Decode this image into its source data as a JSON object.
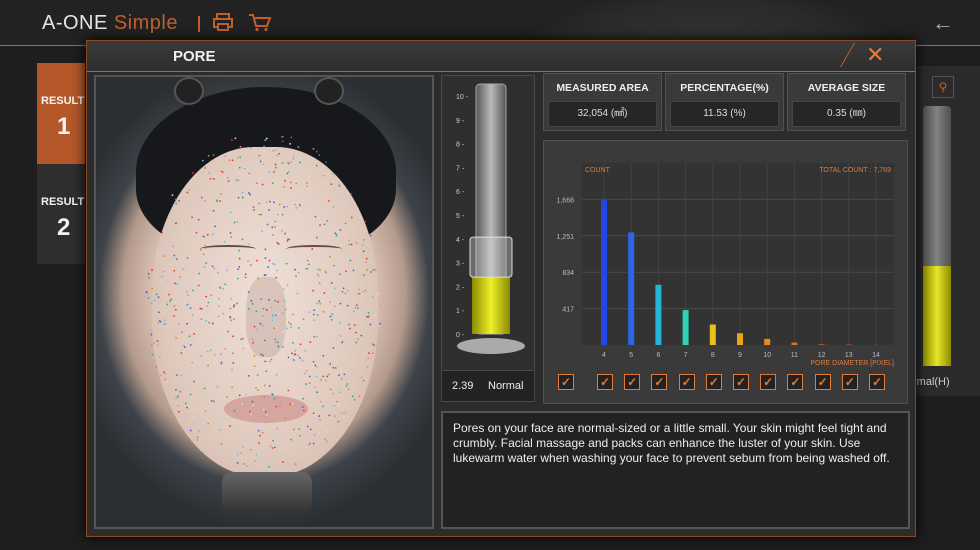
{
  "app": {
    "brand": "A-ONE",
    "brand_sub": "Simple",
    "back_icon": "back-arrow-icon",
    "print_icon": "printer-icon",
    "cart_icon": "cart-icon"
  },
  "results": [
    {
      "label": "RESULT",
      "number": "1",
      "color": "#b4582a"
    },
    {
      "label": "RESULT",
      "number": "2",
      "color": "#2e2e2e"
    }
  ],
  "background_right": {
    "label": "rmal(H)"
  },
  "modal": {
    "title": "PORE",
    "close_label": "✕",
    "stats": [
      {
        "label": "MEASURED AREA",
        "value": "32,054 (㎟)"
      },
      {
        "label": "PERCENTAGE(%)",
        "value": "11.53 (%)"
      },
      {
        "label": "AVERAGE SIZE",
        "value": "0.35 (㎜)"
      }
    ],
    "gauge": {
      "value": "2.39",
      "status": "Normal",
      "level": 2.39,
      "max": 10,
      "ticks": [
        "10 -",
        "9 -",
        "8 -",
        "7 -",
        "6 -",
        "5 -",
        "4 -",
        "3 -",
        "2 -",
        "1 -",
        "0 -"
      ]
    },
    "description": "Pores on your face are normal-sized or a little small. Your skin might feel tight and crumbly. Facial massage and packs can enhance the luster of your skin. Use lukewarm water when washing your face to prevent sebum from being washed off."
  },
  "chart_data": {
    "type": "bar",
    "ylabel": "COUNT",
    "xlabel": "PORE DIAMETER [PIXEL]",
    "total_label": "TOTAL COUNT : 7,769",
    "categories": [
      "4",
      "5",
      "6",
      "7",
      "8",
      "9",
      "10",
      "11",
      "12",
      "13",
      "14"
    ],
    "values": [
      1660,
      1290,
      690,
      400,
      235,
      135,
      70,
      28,
      8,
      5,
      2
    ],
    "colors": [
      "#2346e6",
      "#2a66e8",
      "#27b4d6",
      "#2ed3b7",
      "#e6c21a",
      "#e8a51a",
      "#e88a1e",
      "#e06a24",
      "#e05a22",
      "#e05a22",
      "#e05a22"
    ],
    "ylim": [
      0,
      2085
    ],
    "yticks": [
      417,
      834,
      1251,
      1668
    ],
    "ytick_labels": [
      "417",
      "834",
      "1,251",
      "1,668"
    ],
    "grid": true,
    "checkboxes": [
      true,
      true,
      true,
      true,
      true,
      true,
      true,
      true,
      true,
      true,
      true,
      true
    ]
  }
}
